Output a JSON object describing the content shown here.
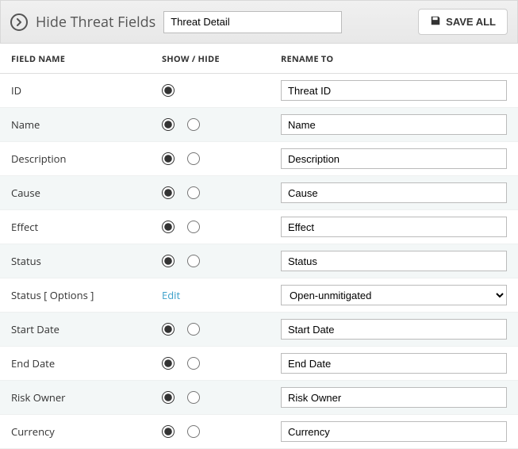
{
  "header": {
    "title": "Hide Threat Fields",
    "input_value": "Threat Detail",
    "save_label": "SAVE ALL"
  },
  "columns": {
    "field_name": "FIELD NAME",
    "show_hide": "SHOW / HIDE",
    "rename_to": "RENAME TO"
  },
  "edit_label": "Edit",
  "rows": [
    {
      "name": "ID",
      "type": "radio_single",
      "show": true,
      "rename": "Threat ID"
    },
    {
      "name": "Name",
      "type": "radio_pair",
      "show": true,
      "rename": "Name"
    },
    {
      "name": "Description",
      "type": "radio_pair",
      "show": true,
      "rename": "Description"
    },
    {
      "name": "Cause",
      "type": "radio_pair",
      "show": true,
      "rename": "Cause"
    },
    {
      "name": "Effect",
      "type": "radio_pair",
      "show": true,
      "rename": "Effect"
    },
    {
      "name": "Status",
      "type": "radio_pair",
      "show": true,
      "rename": "Status"
    },
    {
      "name": "Status [ Options ]",
      "type": "edit_link",
      "select_value": "Open-unmitigated",
      "options": [
        "Open-unmitigated"
      ]
    },
    {
      "name": "Start Date",
      "type": "radio_pair",
      "show": true,
      "rename": "Start Date"
    },
    {
      "name": "End Date",
      "type": "radio_pair",
      "show": true,
      "rename": "End Date"
    },
    {
      "name": "Risk Owner",
      "type": "radio_pair",
      "show": true,
      "rename": "Risk Owner"
    },
    {
      "name": "Currency",
      "type": "radio_pair",
      "show": true,
      "rename": "Currency"
    }
  ]
}
